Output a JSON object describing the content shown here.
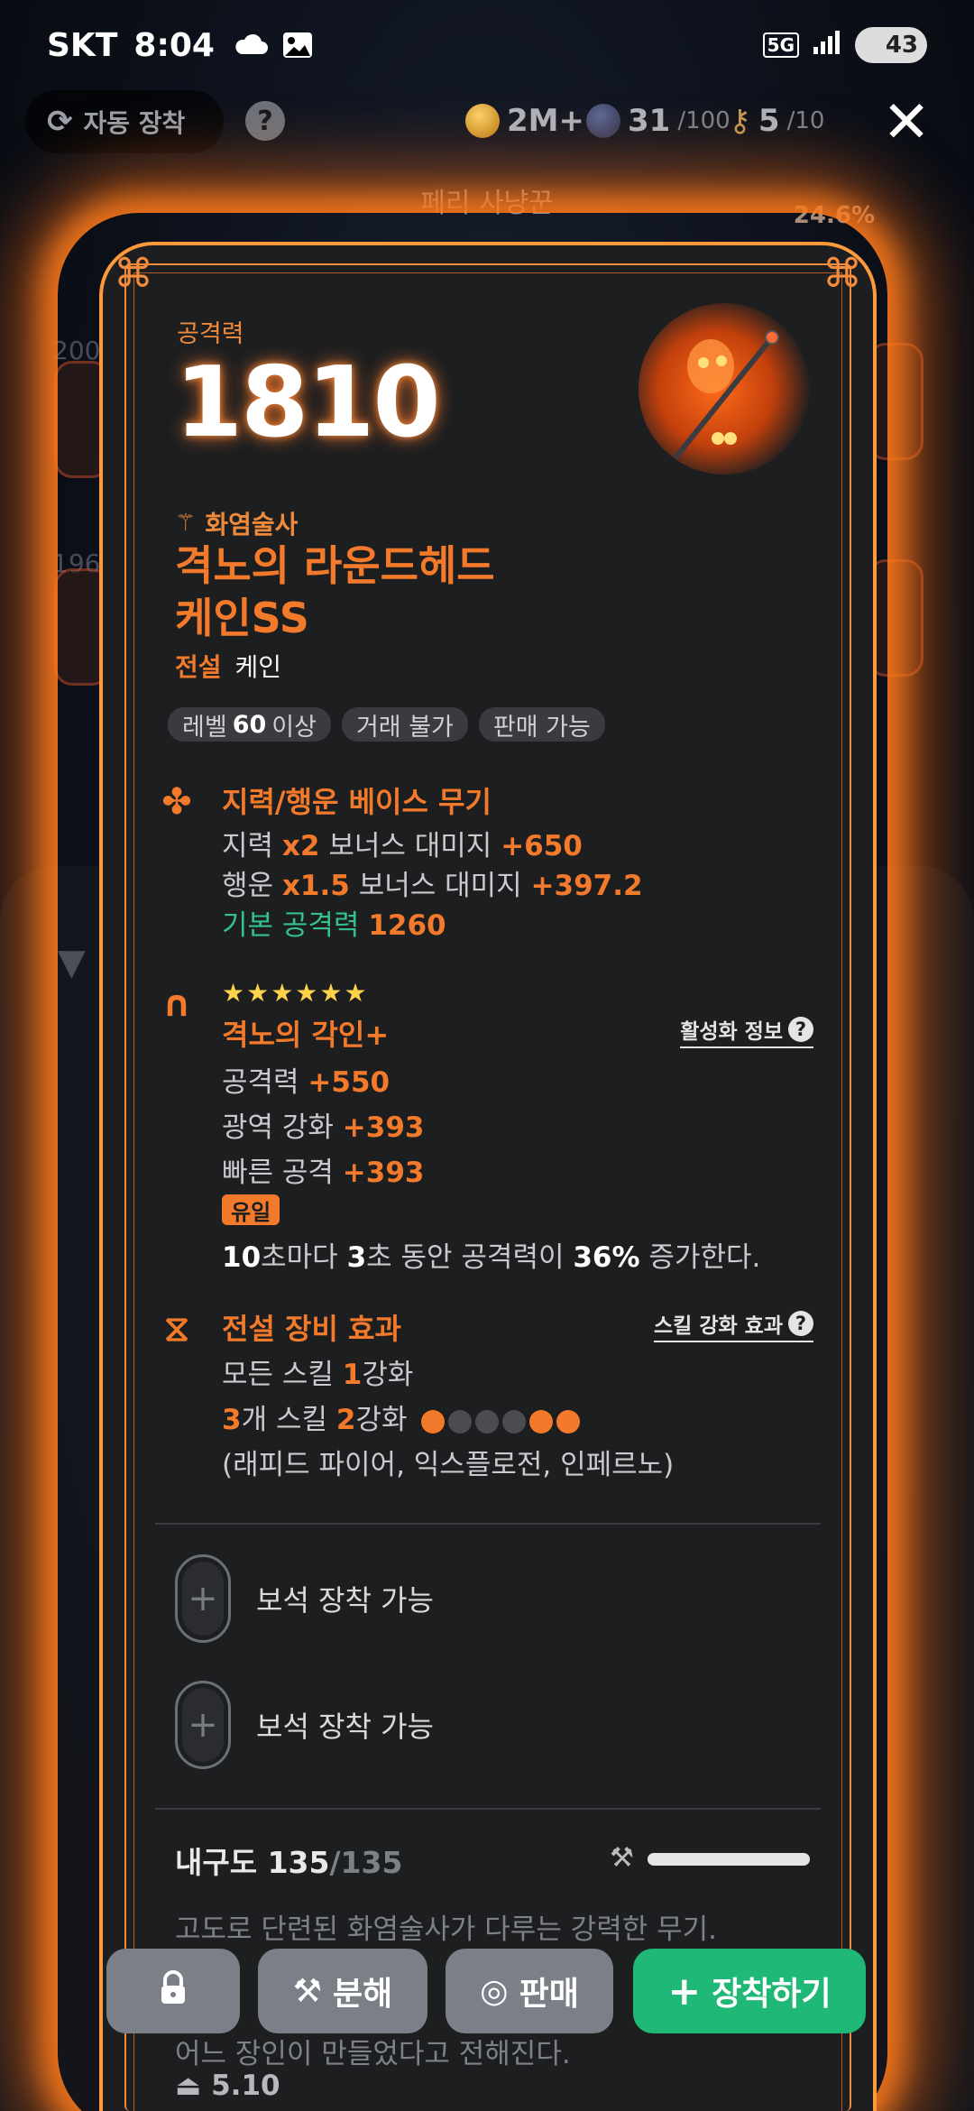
{
  "status_bar": {
    "carrier": "SKT",
    "time": "8:04",
    "network": "5G",
    "battery": "43"
  },
  "top_bar": {
    "auto_equip_label": "자동 장착",
    "help_label": "?",
    "gold": "2M+",
    "orbs": "31",
    "orbs_max": "/100",
    "keys": "5",
    "keys_max": "/10"
  },
  "background": {
    "title": "페리 사냥꾼",
    "percent": "24.6%",
    "ghost_numbers": [
      "200",
      "196"
    ]
  },
  "item": {
    "stat_label": "공격력",
    "stat_value": "1810",
    "class_name": "화염술사",
    "name_line1": "격노의 라운드헤드",
    "name_line2": "케인SS",
    "grade": "전설",
    "type": "케인",
    "tags": [
      {
        "prefix": "레벨",
        "bold": "60",
        "suffix": "이상"
      },
      {
        "prefix": "거래 불가",
        "bold": "",
        "suffix": ""
      },
      {
        "prefix": "판매 가능",
        "bold": "",
        "suffix": ""
      }
    ]
  },
  "base_section": {
    "title": "지력/행운 베이스 무기",
    "line1": {
      "a": "지력",
      "b": "x2",
      "c": "보너스 대미지",
      "d": "+650"
    },
    "line2": {
      "a": "행운",
      "b": "x1.5",
      "c": "보너스 대미지",
      "d": "+397.2"
    },
    "line3": {
      "a": "기본 공격력",
      "b": "1260"
    }
  },
  "rune_section": {
    "stars": "★★★★★★",
    "title": "격노의 각인+",
    "info_link": "활성화 정보",
    "stats": [
      {
        "name": "공격력",
        "value": "+550"
      },
      {
        "name": "광역 강화",
        "value": "+393"
      },
      {
        "name": "빠른 공격",
        "value": "+393"
      }
    ],
    "unique_badge": "유일",
    "effect": {
      "n1": "10",
      "t1": "초마다",
      "n2": "3",
      "t2": "초 동안 공격력이",
      "n3": "36%",
      "t3": "증가한다."
    }
  },
  "legend_section": {
    "title": "전설 장비 효과",
    "info_link": "스킬 강화 효과",
    "line1": {
      "a": "모든 스킬",
      "b": "1",
      "c": "강화"
    },
    "line2": {
      "a": "3",
      "b": "개 스킬",
      "c": "2",
      "d": "강화"
    },
    "dots": [
      "#f37a2a",
      "#4a4c52",
      "#4a4c52",
      "#4a4c52",
      "#f37a2a",
      "#f37a2a"
    ],
    "skills": "(래피드 파이어, 익스플로전, 인페르노)"
  },
  "gem_slots": [
    {
      "label": "보석 장착 가능"
    },
    {
      "label": "보석 장착 가능"
    }
  ],
  "durability": {
    "label": "내구도",
    "current": "135",
    "max": "/135",
    "fill_fraction": 1.0
  },
  "description": {
    "line1": "고도로 단련된 화염술사가 다루는 강력한 무기.",
    "line4": "어느 장인이 만들었다고 전해진다."
  },
  "footer_value": "5.10",
  "buttons": {
    "disassemble": "분해",
    "sell": "판매",
    "equip": "장착하기"
  },
  "colors": {
    "accent": "#f37a2a",
    "equip": "#1fb876",
    "stat_green": "#34c28a",
    "star": "#ffd24a"
  }
}
